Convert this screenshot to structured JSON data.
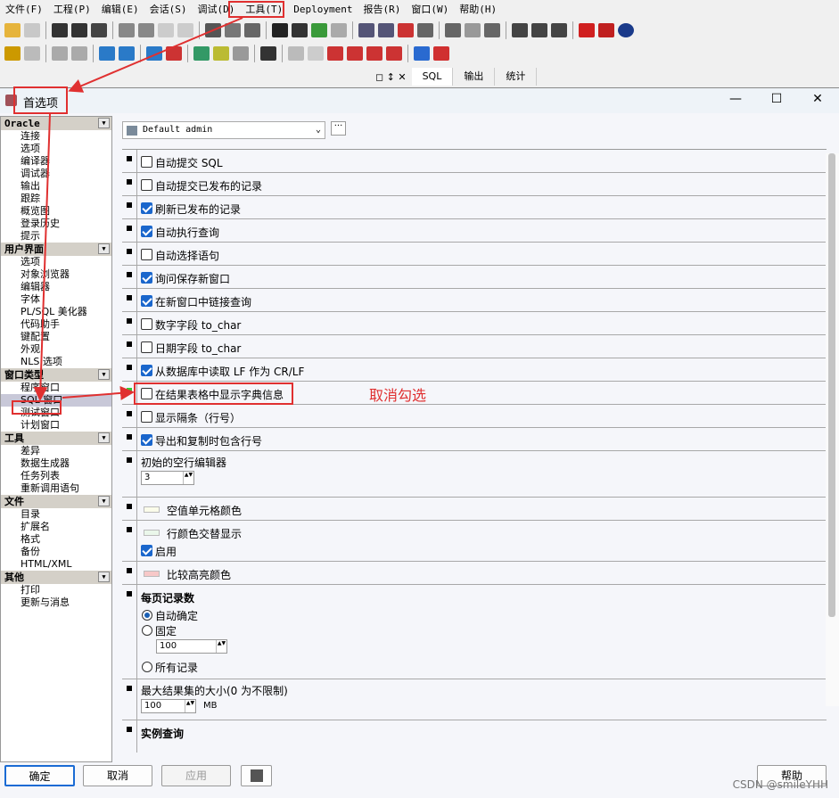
{
  "menu": [
    "文件(F)",
    "工程(P)",
    "编辑(E)",
    "会话(S)",
    "调试(D)",
    "工具(T)",
    "Deployment",
    "报告(R)",
    "窗口(W)",
    "帮助(H)"
  ],
  "tabs": [
    "SQL",
    "输出",
    "统计"
  ],
  "dialog": {
    "title": "首选项",
    "minimize": "—",
    "maximize": "☐",
    "close": "✕"
  },
  "connection_combo": "Default admin",
  "more_button": "···",
  "sidebar": {
    "groups": [
      {
        "label": "Oracle",
        "items": [
          "连接",
          "选项",
          "编译器",
          "调试器",
          "输出",
          "跟踪",
          "概览图",
          "登录历史",
          "提示"
        ]
      },
      {
        "label": "用户界面",
        "items": [
          "选项",
          "对象浏览器",
          "编辑器",
          "字体",
          "PL/SQL 美化器",
          "代码助手",
          "键配置",
          "外观",
          "NLS 选项"
        ]
      },
      {
        "label": "窗口类型",
        "items": [
          "程序窗口",
          "SQL 窗口",
          "测试窗口",
          "计划窗口"
        ]
      },
      {
        "label": "工具",
        "items": [
          "差异",
          "数据生成器",
          "任务列表",
          "重新调用语句"
        ]
      },
      {
        "label": "文件",
        "items": [
          "目录",
          "扩展名",
          "格式",
          "备份",
          "HTML/XML"
        ]
      },
      {
        "label": "其他",
        "items": [
          "打印",
          "更新与消息"
        ]
      }
    ],
    "selected": "SQL 窗口"
  },
  "checkboxes": [
    {
      "label": "自动提交 SQL",
      "checked": false
    },
    {
      "label": "自动提交已发布的记录",
      "checked": false
    },
    {
      "label": "刷新已发布的记录",
      "checked": true
    },
    {
      "label": "自动执行查询",
      "checked": true
    },
    {
      "label": "自动选择语句",
      "checked": false
    },
    {
      "label": "询问保存新窗口",
      "checked": true
    },
    {
      "label": "在新窗口中链接查询",
      "checked": true
    },
    {
      "label": "数字字段 to_char",
      "checked": false
    },
    {
      "label": "日期字段 to_char",
      "checked": false
    },
    {
      "label": "从数据库中读取 LF 作为 CR/LF",
      "checked": true
    },
    {
      "label": "在结果表格中显示字典信息",
      "checked": false
    },
    {
      "label": "显示隔条（行号）",
      "checked": false
    },
    {
      "label": "导出和复制时包含行号",
      "checked": true
    }
  ],
  "empty_row_editor": {
    "label": "初始的空行编辑器",
    "value": "3"
  },
  "null_cell_color": "空值单元格颜色",
  "row_alt_color": {
    "label": "行颜色交替显示",
    "enable": "启用",
    "checked": true
  },
  "compare_highlight": "比较高亮颜色",
  "records_per_page": {
    "label": "每页记录数",
    "auto": "自动确定",
    "fixed": "固定",
    "fixed_value": "100",
    "all": "所有记录"
  },
  "max_result": {
    "label": "最大结果集的大小(0  为不限制)",
    "value": "100",
    "unit": "MB"
  },
  "instance_query": {
    "label": "实例查询"
  },
  "buttons": {
    "ok": "确定",
    "cancel": "取消",
    "apply": "应用",
    "help": "帮助"
  },
  "annotation": "取消勾选",
  "watermark": "CSDN @smileYHH",
  "colors": {
    "accent": "#1a66cc",
    "annotation": "#e03030"
  }
}
